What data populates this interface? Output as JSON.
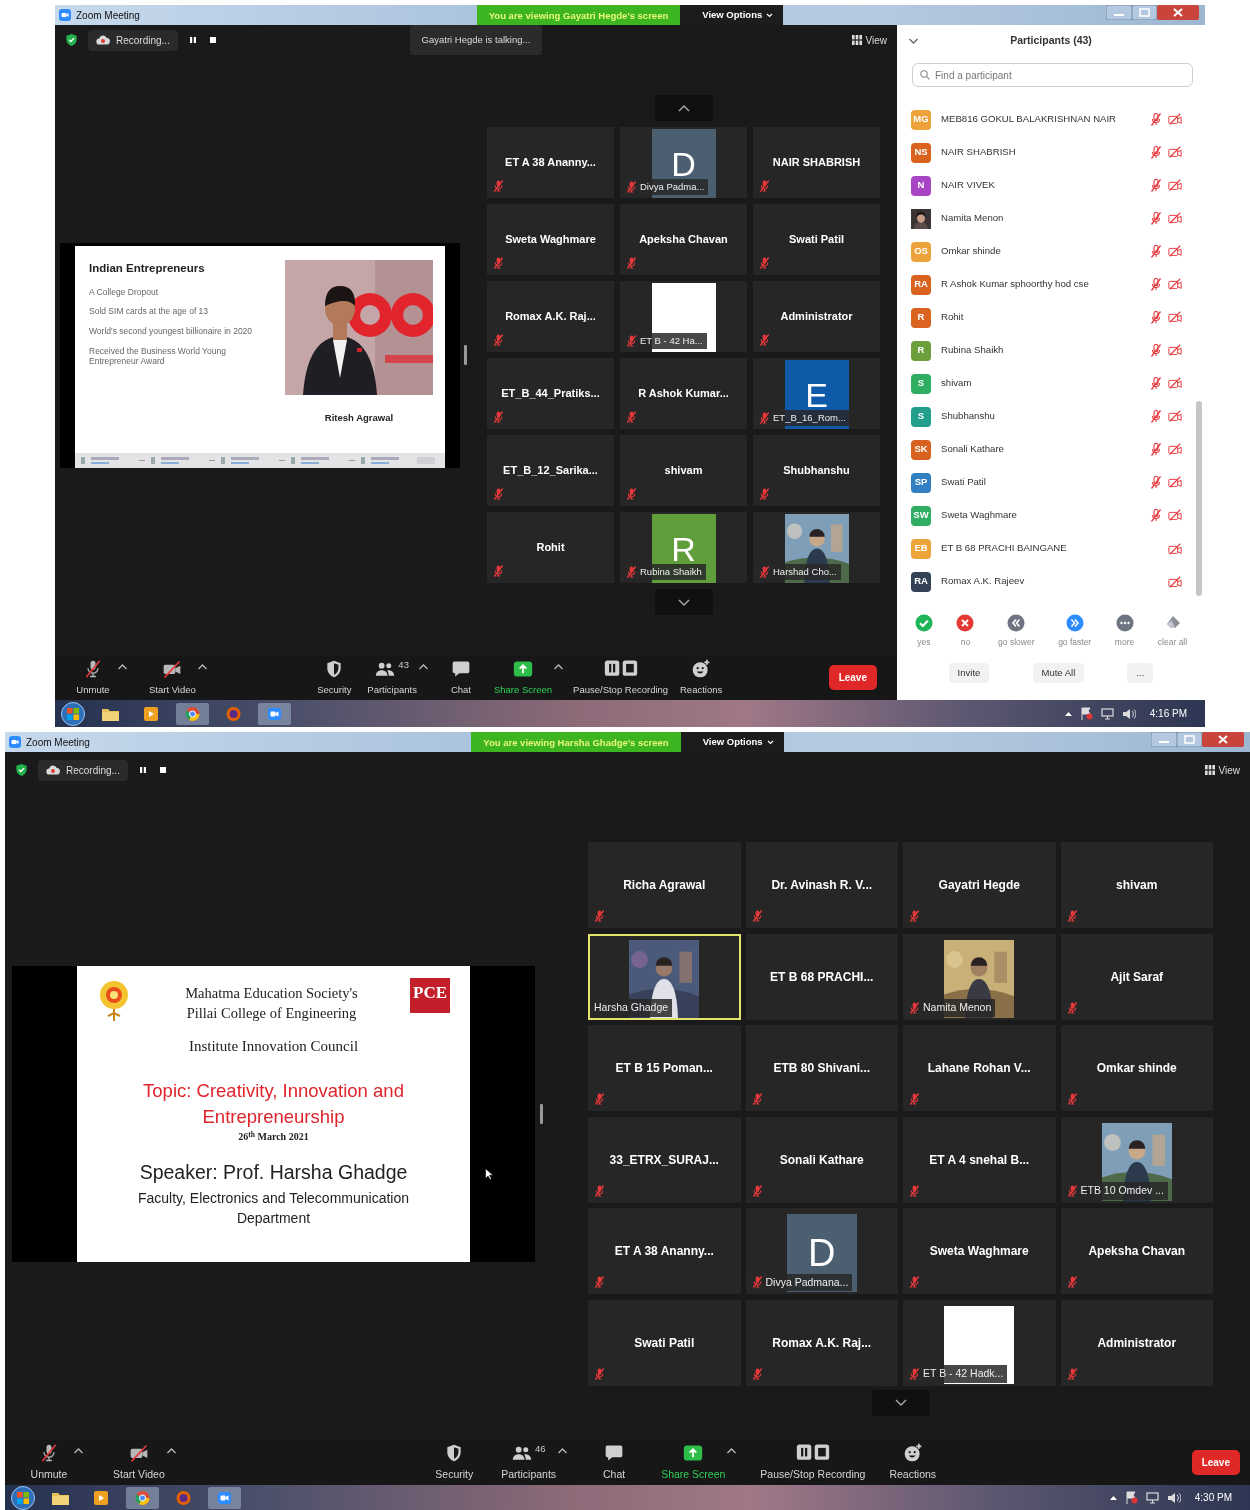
{
  "screens": [
    {
      "title_bar": {
        "title": "Zoom Meeting",
        "banner": "You are viewing Gayatri Hegde's screen",
        "view_options": "View Options"
      },
      "top_bar": {
        "recording": "Recording...",
        "talking": "Gayatri Hegde is talking...",
        "view": "View"
      },
      "slide": {
        "kind": "profile",
        "heading": "Indian Entrepreneurs",
        "points": [
          "A College Dropout",
          "Sold SIM cards at the age of 13",
          "World's second youngest billionaire in 2020",
          "Received the Business World Young Entrepreneur Award"
        ],
        "caption": "Ritesh Agrawal"
      },
      "gallery": {
        "scroll_up": true,
        "scroll_down": true,
        "rows": [
          [
            {
              "name": "ET A 38 Ananny...",
              "kind": "name",
              "muted": true
            },
            {
              "name": "Divya Padma...",
              "kind": "avatar",
              "letter": "D",
              "color": "#4b5f70",
              "muted": true
            },
            {
              "name": "NAIR SHABRISH",
              "kind": "name",
              "muted": true
            }
          ],
          [
            {
              "name": "Sweta Waghmare",
              "kind": "name",
              "muted": true
            },
            {
              "name": "Apeksha Chavan",
              "kind": "name",
              "muted": true
            },
            {
              "name": "Swati Patil",
              "kind": "name",
              "muted": true
            }
          ],
          [
            {
              "name": "Romax A.K. Raj...",
              "kind": "name",
              "muted": true
            },
            {
              "name": "ET B - 42 Ha...",
              "kind": "blank",
              "muted": true
            },
            {
              "name": "Administrator",
              "kind": "name",
              "muted": true
            }
          ],
          [
            {
              "name": "ET_B_44_Pratiks...",
              "kind": "name",
              "muted": true
            },
            {
              "name": "R Ashok Kumar...",
              "kind": "name",
              "muted": true
            },
            {
              "name": "ET_B_16_Rom...",
              "kind": "avatar",
              "letter": "E",
              "color": "#0f5aa8",
              "muted": true
            }
          ],
          [
            {
              "name": "ET_B_12_Sarika...",
              "kind": "name",
              "muted": true
            },
            {
              "name": "shivam",
              "kind": "name",
              "muted": true
            },
            {
              "name": "Shubhanshu",
              "kind": "name",
              "muted": true
            }
          ],
          [
            {
              "name": "Rohit",
              "kind": "name",
              "muted": true
            },
            {
              "name": "Rubina Shaikh",
              "kind": "avatar",
              "letter": "R",
              "color": "#5f9e3a",
              "muted": true
            },
            {
              "name": "Harshad Cho...",
              "muted": true
            }
          ]
        ]
      },
      "participants_panel": {
        "title": "Participants (43)",
        "search_placeholder": "Find a participant",
        "items": [
          {
            "kind": "initials",
            "initials": "MG",
            "color": "#eda33a",
            "name": "MEB816 GOKUL BALAKRISHNAN NAIR",
            "mic_muted": true,
            "video_off": true
          },
          {
            "kind": "initials",
            "initials": "NS",
            "color": "#d9621f",
            "name": "NAIR SHABRISH",
            "mic_muted": true,
            "video_off": true
          },
          {
            "kind": "initials",
            "initials": "N",
            "color": "#a845c4",
            "name": "NAIR VIVEK",
            "mic_muted": true,
            "video_off": true
          },
          {
            "name": "Namita Menon",
            "mic_muted": true,
            "video_off": true
          },
          {
            "kind": "initials",
            "initials": "OS",
            "color": "#eda33b",
            "name": "Omkar shinde",
            "mic_muted": true,
            "video_off": true
          },
          {
            "kind": "initials",
            "initials": "RA",
            "color": "#d9621e",
            "name": "R Ashok Kumar sphoorthy hod cse",
            "mic_muted": true,
            "video_off": true
          },
          {
            "kind": "initials",
            "initials": "R",
            "color": "#d9631f",
            "name": "Rohit",
            "mic_muted": true,
            "video_off": true
          },
          {
            "kind": "initials",
            "initials": "R",
            "color": "#6c9f3b",
            "name": "Rubina Shaikh",
            "mic_muted": true,
            "video_off": true
          },
          {
            "kind": "initials",
            "initials": "S",
            "color": "#2fae62",
            "name": "shivam",
            "mic_muted": true,
            "video_off": true
          },
          {
            "kind": "initials",
            "initials": "S",
            "color": "#219f8c",
            "name": "Shubhanshu",
            "mic_muted": true,
            "video_off": true
          },
          {
            "kind": "initials",
            "initials": "SK",
            "color": "#d8621f",
            "name": "Sonali Kathare",
            "mic_muted": true,
            "video_off": true
          },
          {
            "kind": "initials",
            "initials": "SP",
            "color": "#2f7fc1",
            "name": "Swati Patil",
            "mic_muted": true,
            "video_off": true
          },
          {
            "kind": "initials",
            "initials": "SW",
            "color": "#2fae63",
            "name": "Sweta Waghmare",
            "mic_muted": true,
            "video_off": true
          },
          {
            "kind": "initials",
            "initials": "EB",
            "color": "#eda43a",
            "name": "ET B 68 PRACHI BAINGANE",
            "mic_muted": false,
            "video_off": true
          },
          {
            "kind": "initials",
            "initials": "RA",
            "color": "#344256",
            "name": "Romax A.K. Rajeev",
            "mic_muted": false,
            "video_off": true
          }
        ],
        "reactions": [
          {
            "kind": "yes",
            "label": "yes"
          },
          {
            "kind": "no",
            "label": "no"
          },
          {
            "kind": "slower",
            "label": "go slower"
          },
          {
            "kind": "faster",
            "label": "go faster"
          },
          {
            "kind": "more",
            "label": "more"
          },
          {
            "kind": "clear",
            "label": "clear all"
          }
        ],
        "buttons": [
          "Invite",
          "Mute All",
          "..."
        ]
      },
      "toolbar": {
        "items": [
          {
            "kind": "unmute",
            "label": "Unmute",
            "caret": true
          },
          {
            "kind": "video",
            "label": "Start Video",
            "caret": true
          },
          {
            "kind": "security",
            "label": "Security",
            "caret": false
          },
          {
            "kind": "participants",
            "label": "Participants",
            "count": "43",
            "caret": true
          },
          {
            "kind": "chat",
            "label": "Chat",
            "caret": false
          },
          {
            "kind": "share",
            "label": "Share Screen",
            "caret": true
          },
          {
            "kind": "recording",
            "label": "Pause/Stop Recording",
            "caret": false
          },
          {
            "kind": "reactions",
            "label": "Reactions",
            "caret": false
          }
        ],
        "leave": "Leave"
      },
      "taskbar": {
        "time": "4:16 PM"
      }
    },
    {
      "title_bar": {
        "title": "Zoom Meeting",
        "banner": "You are viewing Harsha Ghadge's screen",
        "view_options": "View Options"
      },
      "top_bar": {
        "recording": "Recording...",
        "view": "View"
      },
      "slide": {
        "kind": "title",
        "institution": [
          "Mahatma Education Society's",
          "Pillai College of Engineering"
        ],
        "logo_text": "PCE",
        "council": "Institute Innovation Council",
        "topic": "Topic: Creativity, Innovation and Entrepreneurship",
        "date": "26$^{th}$ March 2021",
        "speaker": "Speaker: Prof. Harsha Ghadge",
        "department": "Faculty, Electronics and Telecommunication Department"
      },
      "gallery": {
        "scroll_up": false,
        "scroll_down": true,
        "rows": [
          [
            {
              "name": "Richa Agrawal",
              "kind": "name",
              "muted": true,
              "highlighted": false
            },
            {
              "name": "Dr. Avinash R. V...",
              "kind": "name",
              "muted": true,
              "highlighted": false
            },
            {
              "name": "Gayatri Hegde",
              "kind": "name",
              "muted": true,
              "highlighted": false
            },
            {
              "name": "shivam",
              "kind": "name",
              "muted": true,
              "highlighted": false
            }
          ],
          [
            {
              "name": "Harsha Ghadge",
              "muted": false,
              "highlighted": true
            },
            {
              "name": "ET B 68 PRACHI...",
              "kind": "name",
              "muted": false,
              "highlighted": false
            },
            {
              "name": "Namita Menon",
              "muted": true,
              "highlighted": false
            },
            {
              "name": "Ajit Saraf",
              "kind": "name",
              "muted": true,
              "highlighted": false
            }
          ],
          [
            {
              "name": "ET B 15 Poman...",
              "kind": "name",
              "muted": true,
              "highlighted": false
            },
            {
              "name": "ETB 80 Shivani...",
              "kind": "name",
              "muted": true,
              "highlighted": false
            },
            {
              "name": "Lahane Rohan V...",
              "kind": "name",
              "muted": true,
              "highlighted": false
            },
            {
              "name": "Omkar shinde",
              "kind": "name",
              "muted": true,
              "highlighted": false
            }
          ],
          [
            {
              "name": "33_ETRX_SURAJ...",
              "kind": "name",
              "muted": true,
              "highlighted": false
            },
            {
              "name": "Sonali Kathare",
              "kind": "name",
              "muted": true,
              "highlighted": false
            },
            {
              "name": "ET A 4 snehal B...",
              "kind": "name",
              "muted": true,
              "highlighted": false
            },
            {
              "name": "ETB 10 Omdev ...",
              "muted": true,
              "highlighted": false
            }
          ],
          [
            {
              "name": "ET A 38 Ananny...",
              "kind": "name",
              "muted": true,
              "highlighted": false
            },
            {
              "name": "Divya Padmana...",
              "kind": "avatar",
              "letter": "D",
              "color": "#4b5f70",
              "muted": true,
              "highlighted": false
            },
            {
              "name": "Sweta Waghmare",
              "kind": "name",
              "muted": true,
              "highlighted": false
            },
            {
              "name": "Apeksha Chavan",
              "kind": "name",
              "muted": true,
              "highlighted": false
            }
          ],
          [
            {
              "name": "Swati Patil",
              "kind": "name",
              "muted": true,
              "highlighted": false
            },
            {
              "name": "Romax A.K. Raj...",
              "kind": "name",
              "muted": true,
              "highlighted": false
            },
            {
              "name": "ET B - 42 Hadk...",
              "kind": "blank",
              "muted": true,
              "highlighted": false
            },
            {
              "name": "Administrator",
              "kind": "name",
              "muted": true,
              "highlighted": false
            }
          ]
        ]
      },
      "toolbar": {
        "items": [
          {
            "kind": "unmute",
            "label": "Unmute",
            "caret": true
          },
          {
            "kind": "video",
            "label": "Start Video",
            "caret": true
          },
          {
            "kind": "security",
            "label": "Security",
            "caret": false
          },
          {
            "kind": "participants",
            "label": "Participants",
            "count": "46",
            "caret": true
          },
          {
            "kind": "chat",
            "label": "Chat",
            "caret": false
          },
          {
            "kind": "share",
            "label": "Share Screen",
            "caret": true
          },
          {
            "kind": "recording",
            "label": "Pause/Stop Recording",
            "caret": false
          },
          {
            "kind": "reactions",
            "label": "Reactions",
            "caret": false
          }
        ],
        "leave": "Leave"
      },
      "taskbar": {
        "time": "4:30 PM"
      }
    }
  ]
}
